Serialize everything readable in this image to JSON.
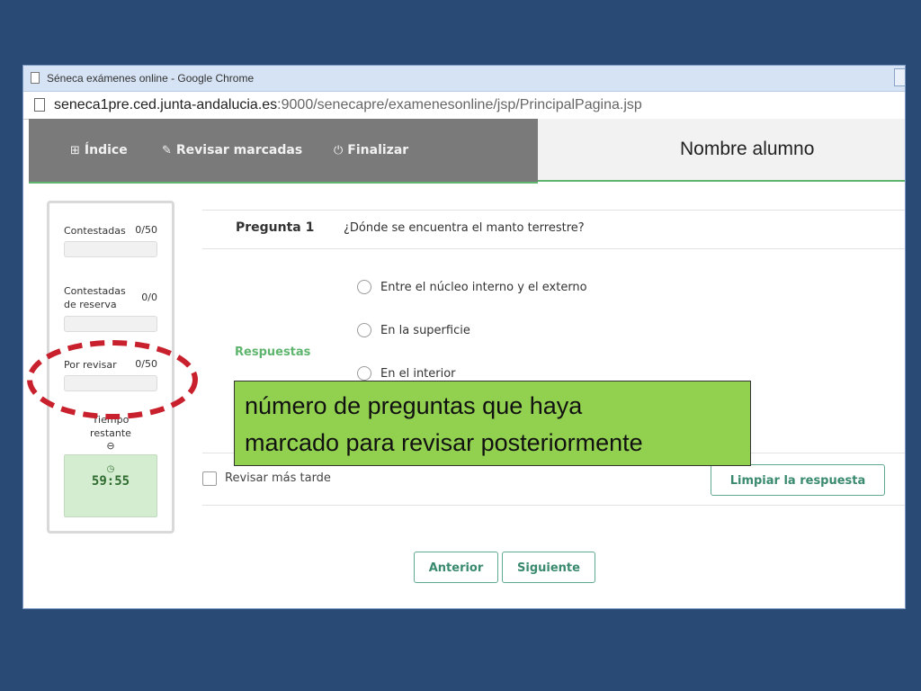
{
  "browser": {
    "title": "Séneca exámenes online - Google Chrome",
    "url_host": "seneca1pre.ced.junta-andalucia.es",
    "url_path": ":9000/senecapre/examenesonline/jsp/PrincipalPagina.jsp"
  },
  "nav": {
    "indice": "Índice",
    "revisar_marcadas": "Revisar marcadas",
    "finalizar": "Finalizar"
  },
  "student": {
    "name": "Nombre alumno"
  },
  "sidebar": {
    "contestadas_label": "Contestadas",
    "contestadas_count": "0/50",
    "reserva_label_1": "Contestadas",
    "reserva_label_2": "de reserva",
    "reserva_count": "0/0",
    "revisar_label": "Por revisar",
    "revisar_count": "0/50",
    "tiempo_label_1": "Tiempo",
    "tiempo_label_2": "restante",
    "timer": "59:55"
  },
  "question": {
    "label": "Pregunta 1",
    "text": "¿Dónde se encuentra el manto terrestre?",
    "answers_label": "Respuestas",
    "options": [
      "Entre el núcleo interno y el externo",
      "En la superficie",
      "En el interior"
    ]
  },
  "controls": {
    "revisar_mas_tarde": "Revisar más tarde",
    "limpiar": "Limpiar la respuesta",
    "anterior": "Anterior",
    "siguiente": "Siguiente"
  },
  "annotation": {
    "line1": "número de preguntas que haya",
    "line2": "marcado para revisar posteriormente",
    "ellipse_color": "#c8202c",
    "box_color": "#92d050"
  }
}
